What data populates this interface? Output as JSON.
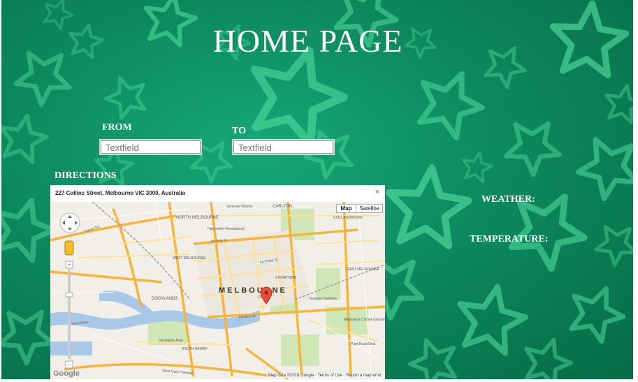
{
  "page": {
    "title": "HOME PAGE",
    "from_label": "FROM",
    "to_label": "TO",
    "from_placeholder": "Textfield",
    "to_placeholder": "Textfield",
    "directions_label": "DIRECTIONS",
    "weather_label": "WEATHER:",
    "temperature_label": "TEMPERATURE:"
  },
  "map": {
    "address": "227 Collins Street, Melbourne VIC 3000, Australia",
    "close": "×",
    "map_button": "Map",
    "satellite_button": "Satellite",
    "city_label": "MELBOURNE",
    "footer": "Map data ©2018 Google · Terms of Use · Report a map error",
    "google_logo": "Google",
    "street_labels": [
      "NORTH MELBOURNE",
      "CARLTON",
      "COLLINGWOOD",
      "DOCKLANDS",
      "CHINATOWN",
      "SOUTH WHARF",
      "Victoria St",
      "Flinders St",
      "La Trobe St",
      "Dynon Rd",
      "Yarra River",
      "Docklands Park",
      "Treasury Gardens",
      "Melbourne Cricket Ground",
      "West Gate Freeway",
      "EAST MELBOURNE",
      "Collins St",
      "Punt Road Oval",
      "WEST MELBOURNE",
      "Services Victoria",
      "Haymarket Roundabout"
    ]
  },
  "colors": {
    "background": "#0d8a5f",
    "star": "#56e3a3",
    "text": "#ffffff"
  }
}
